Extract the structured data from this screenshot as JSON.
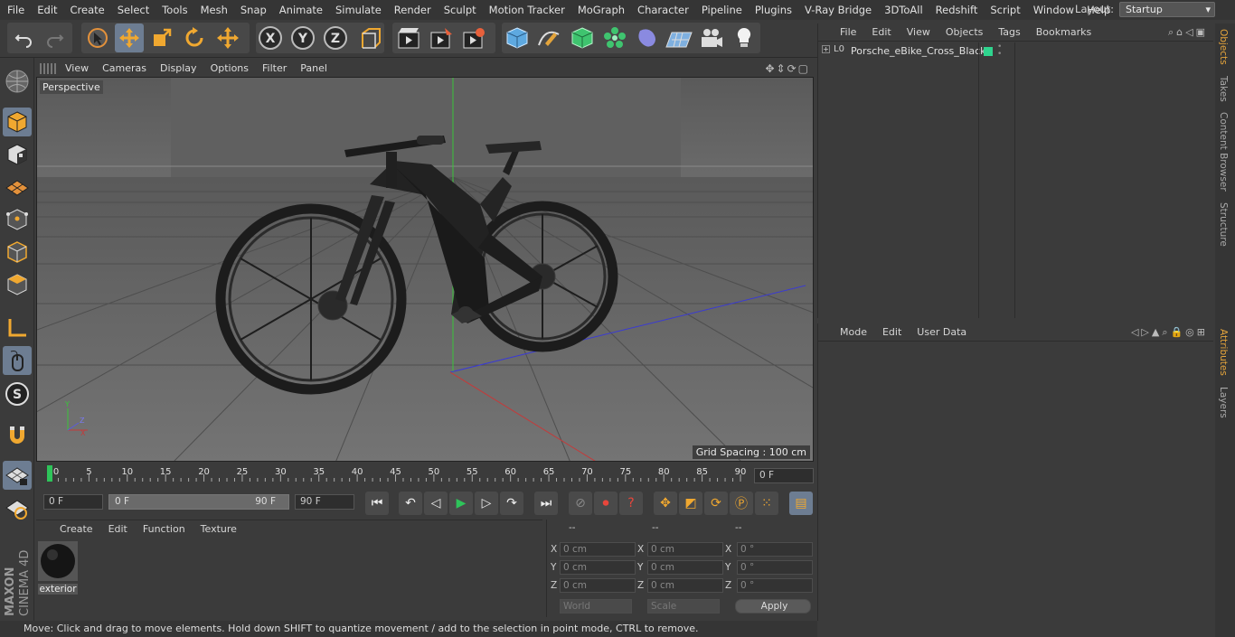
{
  "menubar": {
    "items": [
      "File",
      "Edit",
      "Create",
      "Select",
      "Tools",
      "Mesh",
      "Snap",
      "Animate",
      "Simulate",
      "Render",
      "Sculpt",
      "Motion Tracker",
      "MoGraph",
      "Character",
      "Pipeline",
      "Plugins",
      "V-Ray Bridge",
      "3DToAll",
      "Redshift",
      "Script",
      "Window",
      "Help"
    ],
    "layout_label": "Layout:",
    "layout_value": "Startup"
  },
  "toolbar": {
    "icons": [
      "undo-icon",
      "redo-icon",
      "live-selection-icon",
      "move-icon",
      "scale-icon",
      "rotate-icon",
      "recent-tool-icon",
      "x-axis-icon",
      "y-axis-icon",
      "z-axis-icon",
      "coordinate-system-icon",
      "render-view-icon",
      "render-picture-viewer-icon",
      "edit-render-settings-icon",
      "cube-icon",
      "pen-spline-icon",
      "subdivision-icon",
      "cloner-icon",
      "deformer-icon",
      "floor-icon",
      "camera-icon",
      "light-icon"
    ],
    "x_label": "X",
    "y_label": "Y",
    "z_label": "Z"
  },
  "viewport": {
    "menu": [
      "View",
      "Cameras",
      "Display",
      "Options",
      "Filter",
      "Panel"
    ],
    "label": "Perspective",
    "grid_spacing": "Grid Spacing : 100 cm"
  },
  "timeline": {
    "ticks": [
      "0",
      "5",
      "10",
      "15",
      "20",
      "25",
      "30",
      "35",
      "40",
      "45",
      "50",
      "55",
      "60",
      "65",
      "70",
      "75",
      "80",
      "85",
      "90"
    ],
    "current_frame": "0 F"
  },
  "transport": {
    "start_field": "0 F",
    "range_start": "0 F",
    "range_end": "90 F",
    "end_field": "90 F"
  },
  "materials": {
    "menu": [
      "Create",
      "Edit",
      "Function",
      "Texture"
    ],
    "items": [
      {
        "name": "exterior"
      }
    ]
  },
  "coordinates": {
    "headers": [
      "--",
      "--",
      "--"
    ],
    "rows": [
      {
        "a": "X",
        "av": "0 cm",
        "b": "X",
        "bv": "0 cm",
        "c": "X",
        "cv": "0 °"
      },
      {
        "a": "Y",
        "av": "0 cm",
        "b": "Y",
        "bv": "0 cm",
        "c": "Y",
        "cv": "0 °"
      },
      {
        "a": "Z",
        "av": "0 cm",
        "b": "Z",
        "bv": "0 cm",
        "c": "Z",
        "cv": "0 °"
      }
    ],
    "world": "World",
    "scale": "Scale",
    "apply": "Apply"
  },
  "objects": {
    "menu": [
      "File",
      "Edit",
      "View",
      "Objects",
      "Tags",
      "Bookmarks"
    ],
    "items": [
      {
        "name": "Porsche_eBike_Cross_Black",
        "tag_color": "#2fd48e"
      }
    ]
  },
  "attributes": {
    "menu": [
      "Mode",
      "Edit",
      "User Data"
    ]
  },
  "sidetabs": {
    "top": [
      "Objects",
      "Takes",
      "Content Browser",
      "Structure"
    ],
    "bottom": [
      "Attributes",
      "Layers"
    ]
  },
  "status": "Move: Click and drag to move elements. Hold down SHIFT to quantize movement / add to the selection in point mode, CTRL to remove.",
  "branding": {
    "maxon": "MAXON",
    "product": "CINEMA 4D"
  },
  "colors": {
    "accent": "#e6a53c",
    "selection": "#6d7d92",
    "play": "#2ec45a",
    "x_axis": "#d43a3a",
    "y_axis": "#3ac43a",
    "z_axis": "#3a3ad4"
  }
}
